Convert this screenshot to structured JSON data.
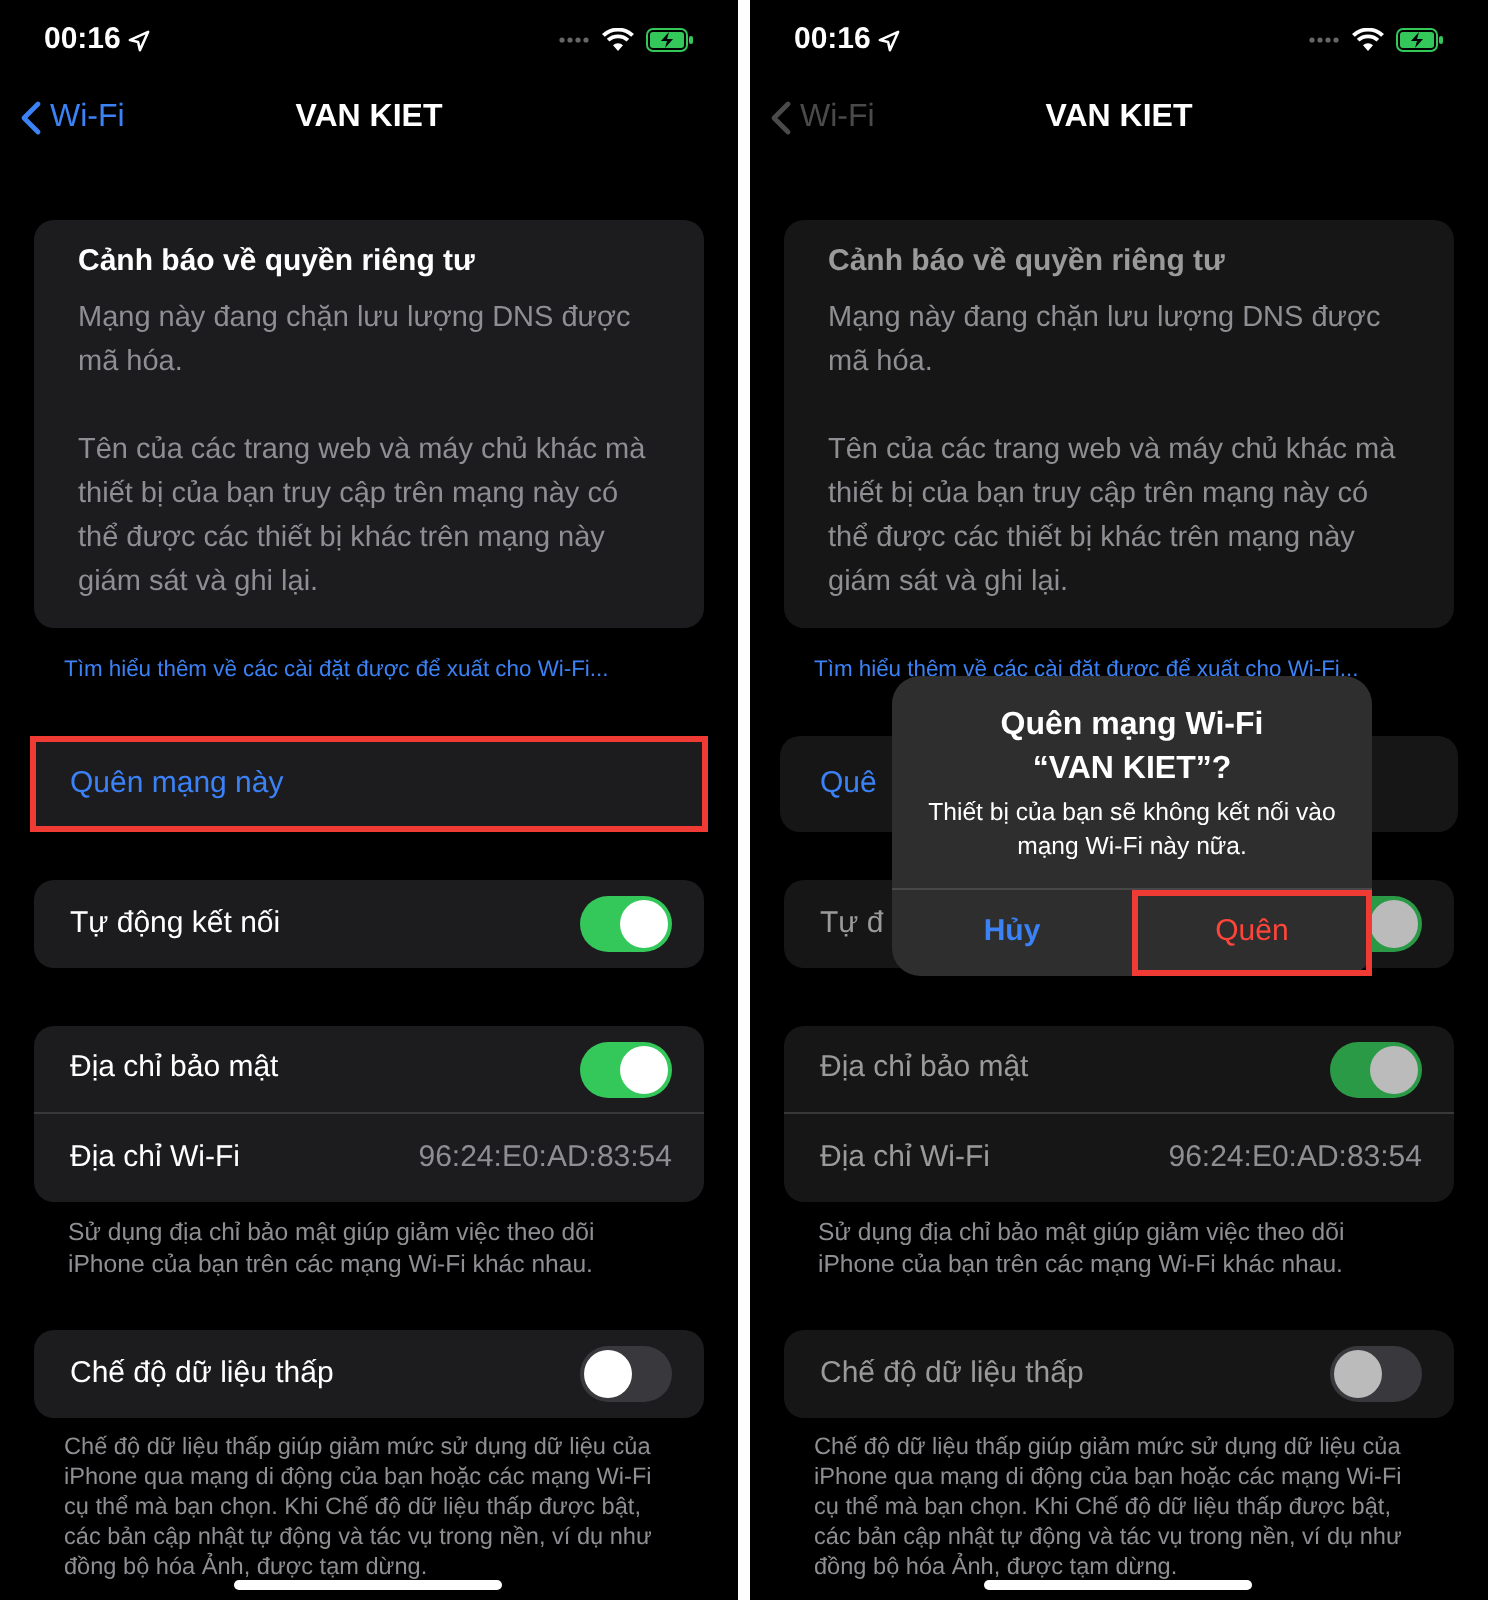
{
  "screens": [
    {
      "dimmed": false,
      "status_bar": {
        "time": "00:16"
      },
      "nav": {
        "back": "Wi-Fi",
        "title": "VAN KIET"
      },
      "privacy_warning": {
        "title": "Cảnh báo về quyền riêng tư",
        "paragraphs": [
          "Mạng này đang chặn lưu lượng DNS được mã hóa.",
          "Tên của các trang web và máy chủ khác mà thiết bị của bạn truy cập trên mạng này có thể được các thiết bị khác trên mạng này giám sát và ghi lại."
        ]
      },
      "learn_more_link": "Tìm hiểu thêm về các cài đặt được để xuất cho Wi-Fi...",
      "forget_row": {
        "label": "Quên mạng này",
        "highlighted": true
      },
      "auto_join": {
        "label": "Tự động kết nối",
        "on": true
      },
      "private_address": {
        "label": "Địa chỉ bảo mật",
        "on": true
      },
      "wifi_address": {
        "label": "Địa chỉ Wi-Fi",
        "value": "96:24:E0:AD:83:54"
      },
      "private_note": "Sử dụng địa chỉ bảo mật giúp giảm việc theo dõi iPhone của bạn trên các mạng Wi-Fi khác nhau.",
      "low_data": {
        "label": "Chế độ dữ liệu thấp",
        "on": false
      },
      "low_data_note": "Chế độ dữ liệu thấp giúp giảm mức sử dụng dữ liệu của iPhone qua mạng di động của bạn hoặc các mạng Wi-Fi cụ thể mà bạn chọn. Khi Chế độ dữ liệu thấp được bật, các bản cập nhật tự động và tác vụ trong nền, ví dụ như đồng bộ hóa Ảnh, được tạm dừng."
    },
    {
      "dimmed": true,
      "status_bar": {
        "time": "00:16"
      },
      "nav": {
        "back": "Wi-Fi",
        "title": "VAN KIET"
      },
      "privacy_warning": {
        "title": "Cảnh báo về quyền riêng tư",
        "paragraphs": [
          "Mạng này đang chặn lưu lượng DNS được mã hóa.",
          "Tên của các trang web và máy chủ khác mà thiết bị của bạn truy cập trên mạng này có thể được các thiết bị khác trên mạng này giám sát và ghi lại."
        ]
      },
      "learn_more_link": "Tìm hiểu thêm về các cài đặt được để xuất cho Wi-Fi...",
      "forget_row": {
        "label": "Quê",
        "highlighted": false
      },
      "auto_join": {
        "label": "Tự đ",
        "on": true
      },
      "private_address": {
        "label": "Địa chỉ bảo mật",
        "on": true
      },
      "wifi_address": {
        "label": "Địa chỉ Wi-Fi",
        "value": "96:24:E0:AD:83:54"
      },
      "private_note": "Sử dụng địa chỉ bảo mật giúp giảm việc theo dõi iPhone của bạn trên các mạng Wi-Fi khác nhau.",
      "low_data": {
        "label": "Chế độ dữ liệu thấp",
        "on": false
      },
      "low_data_note": "Chế độ dữ liệu thấp giúp giảm mức sử dụng dữ liệu của iPhone qua mạng di động của bạn hoặc các mạng Wi-Fi cụ thể mà bạn chọn. Khi Chế độ dữ liệu thấp được bật, các bản cập nhật tự động và tác vụ trong nền, ví dụ như đồng bộ hóa Ảnh, được tạm dừng.",
      "dialog": {
        "title": "Quên mạng Wi-Fi “VAN KIET”?",
        "message": "Thiết bị của bạn sẽ không kết nối vào mạng Wi-Fi này nữa.",
        "buttons": [
          {
            "label": "Hủy",
            "kind": "cancel",
            "highlighted": false
          },
          {
            "label": "Quên",
            "kind": "destructive",
            "highlighted": true
          }
        ]
      }
    }
  ]
}
